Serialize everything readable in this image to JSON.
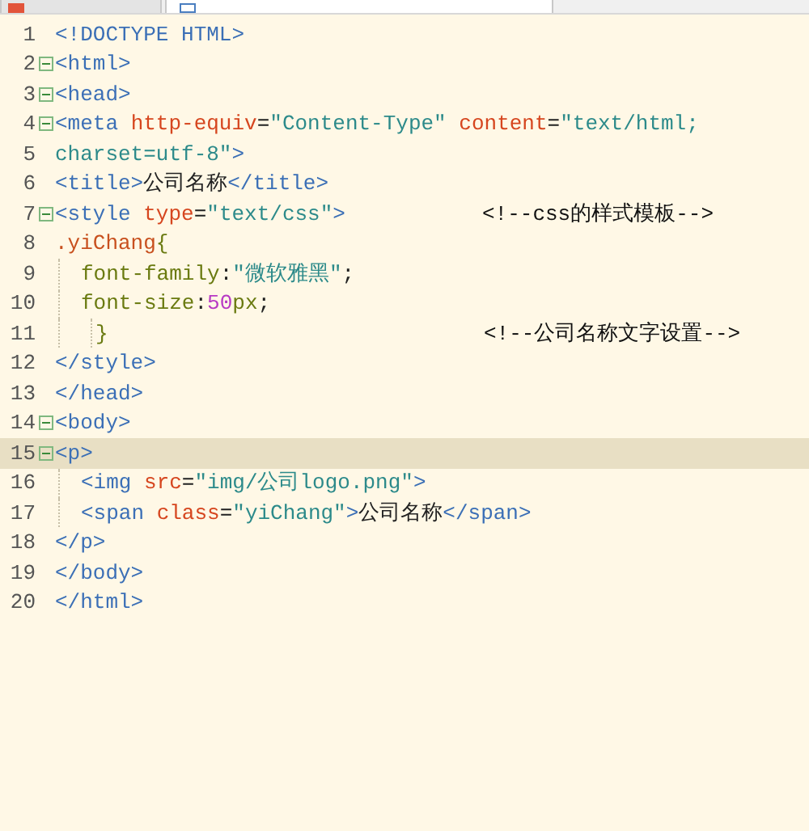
{
  "tabs": [
    {
      "selected": false,
      "kind": "app"
    },
    {
      "selected": true,
      "kind": "file"
    }
  ],
  "editor": {
    "lines": [
      {
        "number": "1",
        "fold": false,
        "highlighted": false,
        "tokens": [
          {
            "kind": "tag",
            "text": "<!DOCTYPE HTML>"
          }
        ]
      },
      {
        "number": "2",
        "fold": true,
        "highlighted": false,
        "tokens": [
          {
            "kind": "tag",
            "text": "<html>"
          }
        ]
      },
      {
        "number": "3",
        "fold": true,
        "highlighted": false,
        "tokens": [
          {
            "kind": "tag",
            "text": "<head>"
          }
        ]
      },
      {
        "number": "4",
        "fold": true,
        "highlighted": false,
        "tokens": [
          {
            "kind": "tag",
            "text": "<meta "
          },
          {
            "kind": "attr",
            "text": "http-equiv"
          },
          {
            "kind": "plain",
            "text": "="
          },
          {
            "kind": "string",
            "text": "\"Content-Type\" "
          },
          {
            "kind": "attr",
            "text": "content"
          },
          {
            "kind": "plain",
            "text": "="
          },
          {
            "kind": "string",
            "text": "\"text/html;"
          }
        ]
      },
      {
        "number": "5",
        "fold": false,
        "highlighted": false,
        "tokens": [
          {
            "kind": "string",
            "text": "charset=utf-8\""
          },
          {
            "kind": "tag",
            "text": ">"
          }
        ]
      },
      {
        "number": "6",
        "fold": false,
        "highlighted": false,
        "tokens": [
          {
            "kind": "tag",
            "text": "<title>"
          },
          {
            "kind": "plain",
            "text": "公司名称"
          },
          {
            "kind": "tag",
            "text": "</title>"
          }
        ]
      },
      {
        "number": "7",
        "fold": true,
        "highlighted": false,
        "tokens": [
          {
            "kind": "tag",
            "text": "<style "
          },
          {
            "kind": "attr",
            "text": "type"
          },
          {
            "kind": "plain",
            "text": "="
          },
          {
            "kind": "string",
            "text": "\"text/css\""
          },
          {
            "kind": "tag",
            "text": ">"
          }
        ],
        "comment": "<!--css的样式模板-->"
      },
      {
        "number": "8",
        "fold": false,
        "highlighted": false,
        "tokens": [
          {
            "kind": "selector",
            "text": ".yiChang"
          },
          {
            "kind": "property",
            "text": "{"
          }
        ]
      },
      {
        "number": "9",
        "fold": false,
        "highlighted": false,
        "indented": true,
        "tokens": [
          {
            "kind": "property",
            "text": "font-family"
          },
          {
            "kind": "plain",
            "text": ":"
          },
          {
            "kind": "string",
            "text": "\"微软雅黑\""
          },
          {
            "kind": "plain",
            "text": ";"
          }
        ]
      },
      {
        "number": "10",
        "fold": false,
        "highlighted": false,
        "indented": true,
        "tokens": [
          {
            "kind": "property",
            "text": "font-size"
          },
          {
            "kind": "plain",
            "text": ":"
          },
          {
            "kind": "number",
            "text": "50"
          },
          {
            "kind": "property",
            "text": "px"
          },
          {
            "kind": "plain",
            "text": ";"
          }
        ]
      },
      {
        "number": "11",
        "fold": false,
        "highlighted": false,
        "indented": true,
        "guide": true,
        "tokens": [
          {
            "kind": "property",
            "text": "}"
          }
        ],
        "comment": "<!--公司名称文字设置-->"
      },
      {
        "number": "12",
        "fold": false,
        "highlighted": false,
        "tokens": [
          {
            "kind": "tag",
            "text": "</style>"
          }
        ]
      },
      {
        "number": "13",
        "fold": false,
        "highlighted": false,
        "tokens": [
          {
            "kind": "tag",
            "text": "</head>"
          }
        ]
      },
      {
        "number": "14",
        "fold": true,
        "highlighted": false,
        "tokens": [
          {
            "kind": "tag",
            "text": "<body>"
          }
        ]
      },
      {
        "number": "15",
        "fold": true,
        "highlighted": true,
        "tokens": [
          {
            "kind": "tag",
            "text": "<p>"
          }
        ]
      },
      {
        "number": "16",
        "fold": false,
        "highlighted": false,
        "indented": true,
        "tokens": [
          {
            "kind": "tag",
            "text": "<img "
          },
          {
            "kind": "attr",
            "text": "src"
          },
          {
            "kind": "plain",
            "text": "="
          },
          {
            "kind": "string",
            "text": "\"img/公司logo.png\""
          },
          {
            "kind": "tag",
            "text": ">"
          }
        ]
      },
      {
        "number": "17",
        "fold": false,
        "highlighted": false,
        "indented": true,
        "tokens": [
          {
            "kind": "tag",
            "text": "<span "
          },
          {
            "kind": "attr",
            "text": "class"
          },
          {
            "kind": "plain",
            "text": "="
          },
          {
            "kind": "string",
            "text": "\"yiChang\""
          },
          {
            "kind": "tag",
            "text": ">"
          },
          {
            "kind": "plain",
            "text": "公司名称"
          },
          {
            "kind": "tag",
            "text": "</span>"
          }
        ]
      },
      {
        "number": "18",
        "fold": false,
        "highlighted": false,
        "tokens": [
          {
            "kind": "tag",
            "text": "</p>"
          }
        ]
      },
      {
        "number": "19",
        "fold": false,
        "highlighted": false,
        "tokens": [
          {
            "kind": "tag",
            "text": "</body>"
          }
        ]
      },
      {
        "number": "20",
        "fold": false,
        "highlighted": false,
        "tokens": [
          {
            "kind": "tag",
            "text": "</html>"
          }
        ]
      }
    ]
  }
}
